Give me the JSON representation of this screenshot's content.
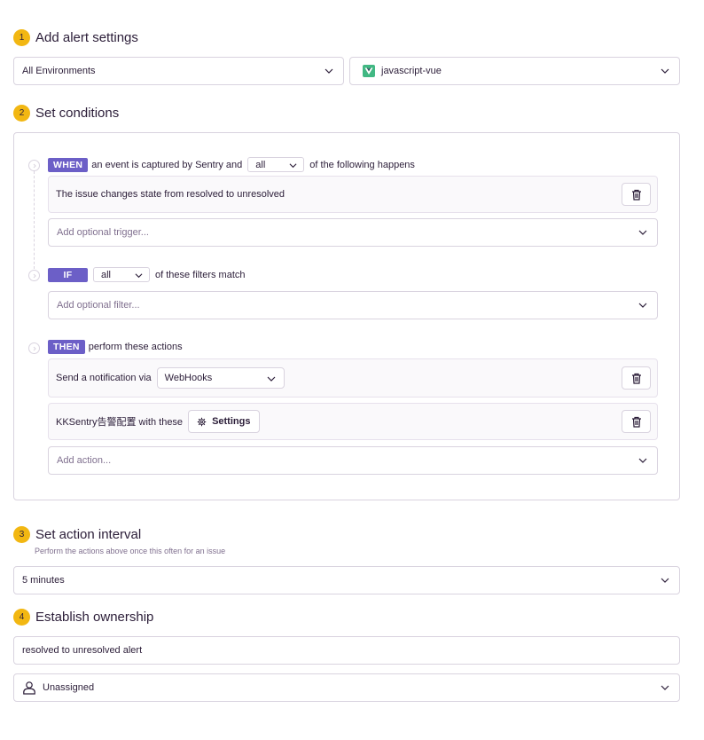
{
  "steps": {
    "step1": {
      "number": "1",
      "title": "Add alert settings"
    },
    "step2": {
      "number": "2",
      "title": "Set conditions"
    },
    "step3": {
      "number": "3",
      "title": "Set action interval",
      "subtitle": "Perform the actions above once this often for an issue"
    },
    "step4": {
      "number": "4",
      "title": "Establish ownership"
    }
  },
  "environment": {
    "value": "All Environments"
  },
  "project": {
    "value": "javascript-vue",
    "icon": "vue-logo-icon",
    "color": "#41b883"
  },
  "when": {
    "badge": "WHEN",
    "text_before": "an event is captured by Sentry and",
    "match": "all",
    "text_after": "of the following happens",
    "condition": "The issue changes state from resolved to unresolved",
    "add_placeholder": "Add optional trigger..."
  },
  "if": {
    "badge": "IF",
    "match": "all",
    "text_after": "of these filters match",
    "add_placeholder": "Add optional filter..."
  },
  "then": {
    "badge": "THEN",
    "text_after": "perform these actions",
    "action1": {
      "text": "Send a notification via",
      "service": "WebHooks"
    },
    "action2": {
      "text": "KKSentry告警配置 with these",
      "settings_label": "Settings"
    },
    "add_placeholder": "Add action..."
  },
  "interval": {
    "value": "5 minutes"
  },
  "ownership": {
    "name_value": "resolved to unresolved alert",
    "owner": "Unassigned"
  },
  "colors": {
    "accent": "#6c5fc7",
    "step": "#f2b712",
    "border": "#d9d3df"
  }
}
